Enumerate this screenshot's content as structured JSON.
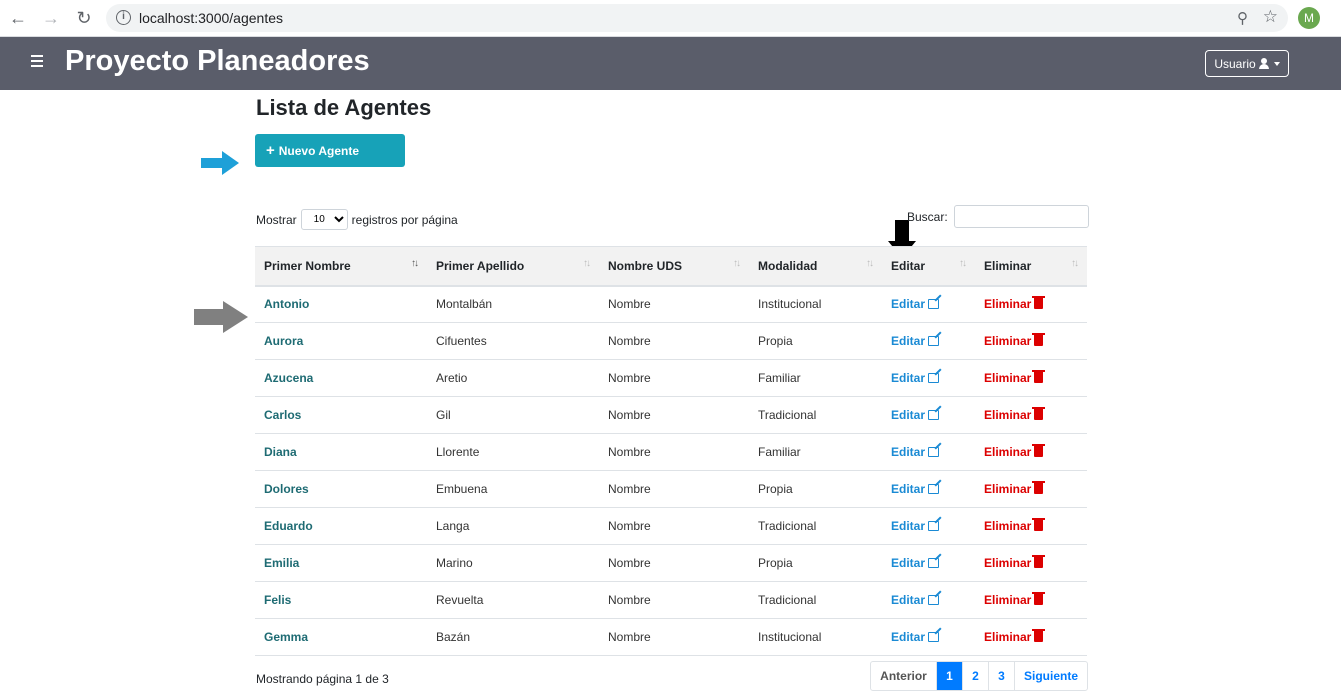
{
  "browser": {
    "url": "localhost:3000/agentes",
    "profile_initial": "M"
  },
  "navbar": {
    "brand": "Proyecto Planeadores",
    "user_label": "Usuario"
  },
  "page": {
    "title": "Lista de Agentes",
    "new_button": "Nuevo Agente"
  },
  "table_controls": {
    "show_prefix": "Mostrar",
    "page_size": "10",
    "show_suffix": "registros por página",
    "search_label": "Buscar:",
    "search_value": ""
  },
  "table": {
    "headers": [
      "Primer Nombre",
      "Primer Apellido",
      "Nombre UDS",
      "Modalidad",
      "Editar",
      "Eliminar"
    ],
    "edit_label": "Editar",
    "delete_label": "Eliminar",
    "rows": [
      {
        "nombre": "Antonio",
        "apellido": "Montalbán",
        "uds": "Nombre",
        "modalidad": "Institucional"
      },
      {
        "nombre": "Aurora",
        "apellido": "Cifuentes",
        "uds": "Nombre",
        "modalidad": "Propia"
      },
      {
        "nombre": "Azucena",
        "apellido": "Aretio",
        "uds": "Nombre",
        "modalidad": "Familiar"
      },
      {
        "nombre": "Carlos",
        "apellido": "Gil",
        "uds": "Nombre",
        "modalidad": "Tradicional"
      },
      {
        "nombre": "Diana",
        "apellido": "Llorente",
        "uds": "Nombre",
        "modalidad": "Familiar"
      },
      {
        "nombre": "Dolores",
        "apellido": "Embuena",
        "uds": "Nombre",
        "modalidad": "Propia"
      },
      {
        "nombre": "Eduardo",
        "apellido": "Langa",
        "uds": "Nombre",
        "modalidad": "Tradicional"
      },
      {
        "nombre": "Emilia",
        "apellido": "Marino",
        "uds": "Nombre",
        "modalidad": "Propia"
      },
      {
        "nombre": "Felis",
        "apellido": "Revuelta",
        "uds": "Nombre",
        "modalidad": "Tradicional"
      },
      {
        "nombre": "Gemma",
        "apellido": "Bazán",
        "uds": "Nombre",
        "modalidad": "Institucional"
      }
    ]
  },
  "footer": {
    "info": "Mostrando página 1 de 3",
    "prev": "Anterior",
    "pages": [
      "1",
      "2",
      "3"
    ],
    "current_page": "1",
    "next": "Siguiente"
  },
  "colors": {
    "navbar": "#5a5d6a",
    "new_button": "#17a2b8",
    "name_link": "#1e6b73",
    "edit": "#1a8ad4",
    "delete": "#dc0000",
    "pager_active": "#007bff",
    "annotation_blue_arrow": "#1ea0d8",
    "annotation_gray_arrow": "#808080",
    "annotation_black_arrow": "#000000"
  }
}
